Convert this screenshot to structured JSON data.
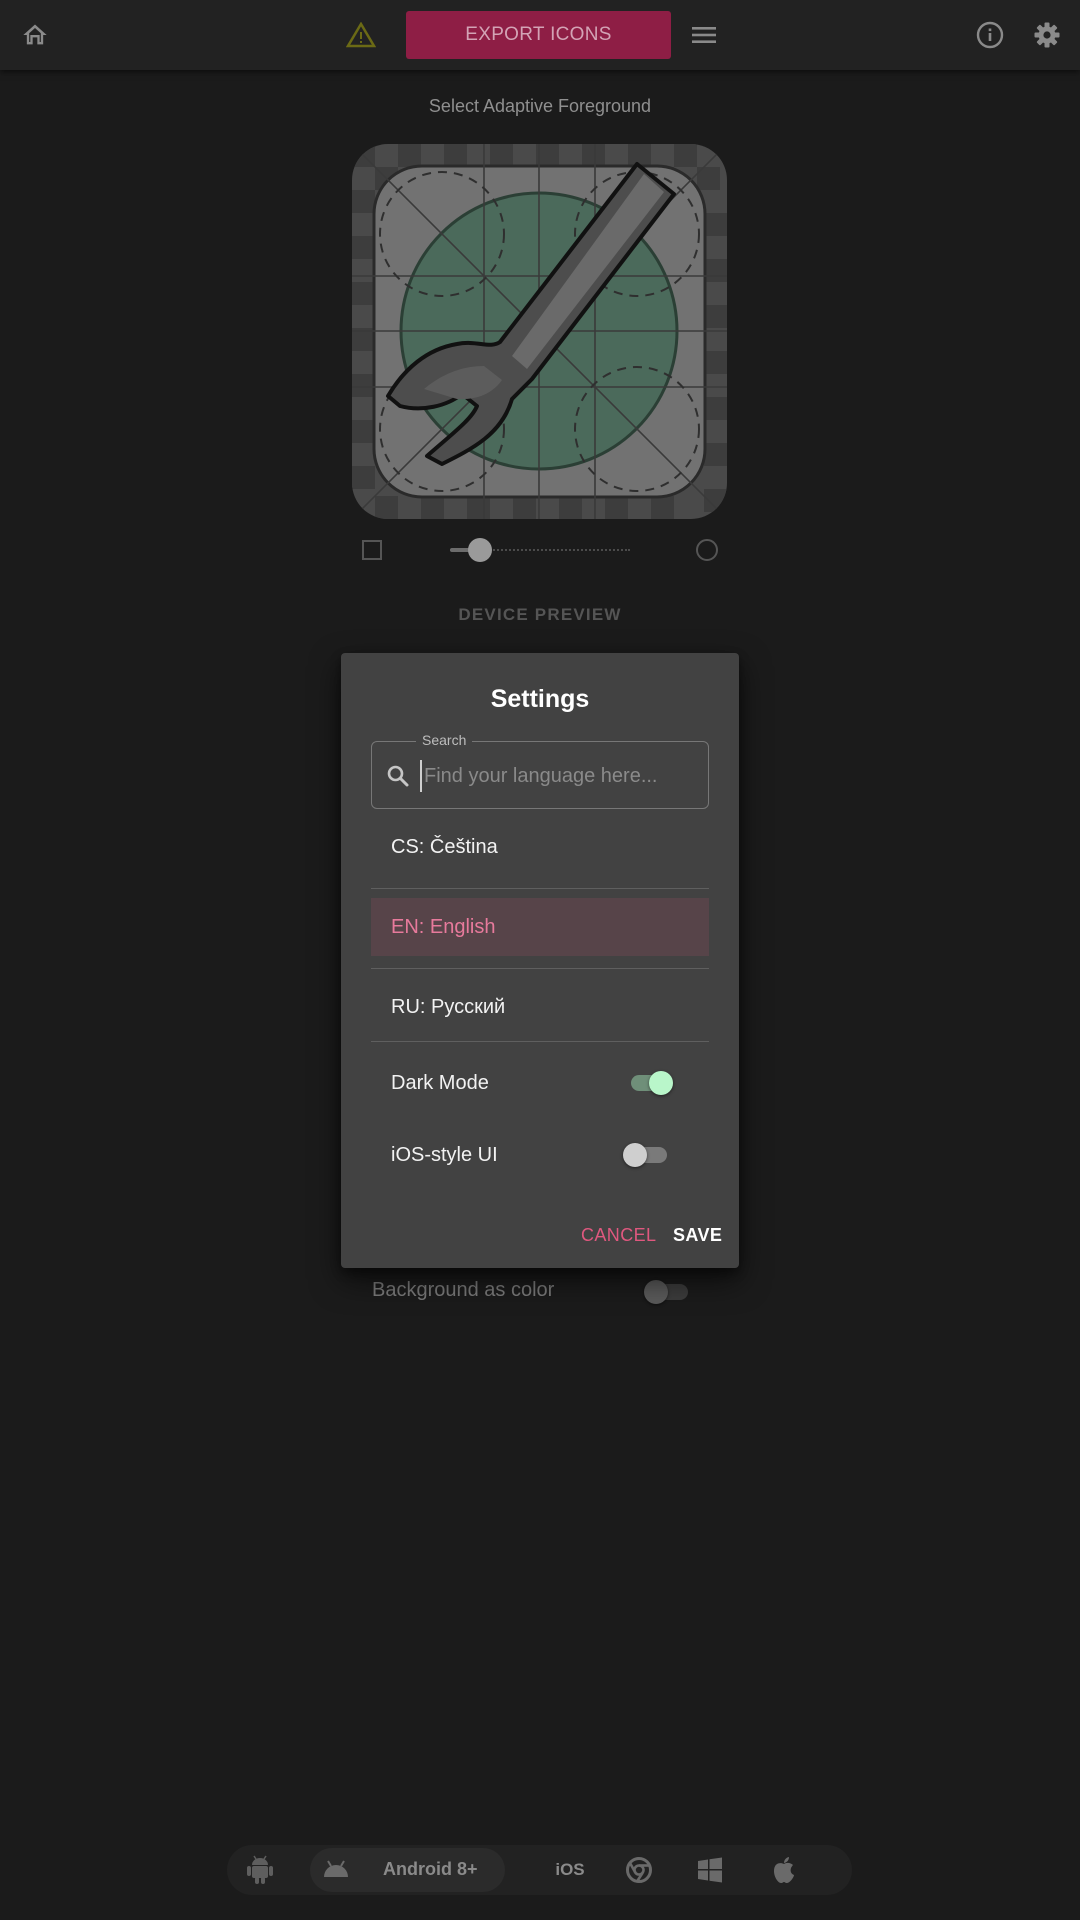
{
  "topbar": {
    "home_icon": "home-icon",
    "warning_icon": "warning-triangle-icon",
    "export_label": "EXPORT ICONS",
    "menu_icon": "hamburger-menu-icon",
    "info_icon": "info-icon",
    "settings_icon": "gear-icon",
    "export_color": "#8e1e45"
  },
  "main": {
    "subtitle": "Select Adaptive Foreground",
    "preview_icon": "wrench-icon",
    "shape_square_icon": "square-shape-icon",
    "shape_circle_icon": "circle-shape-icon",
    "corner_slider_fraction": 0.1,
    "device_preview_label": "DEVICE PREVIEW",
    "background_as_color_label": "Background as color",
    "background_as_color_on": false
  },
  "dialog": {
    "title": "Settings",
    "search": {
      "legend": "Search",
      "placeholder": "Find your language here..."
    },
    "languages": [
      {
        "label": "CS: Čeština",
        "selected": false
      },
      {
        "label": "EN: English",
        "selected": true
      },
      {
        "label": "RU: Русский",
        "selected": false
      }
    ],
    "dark_mode": {
      "label": "Dark Mode",
      "on": true
    },
    "ios_style": {
      "label": "iOS-style UI",
      "on": false
    },
    "cancel_label": "CANCEL",
    "save_label": "SAVE",
    "accent": "#e0587f",
    "toggle_on_color": "#b9f6ca"
  },
  "bottom_nav": {
    "items": [
      {
        "icon": "android-robot-icon"
      },
      {
        "icon": "android-head-icon",
        "label": "Android 8+"
      },
      {
        "label": "iOS"
      },
      {
        "icon": "chrome-icon"
      },
      {
        "icon": "windows-icon"
      },
      {
        "icon": "apple-icon"
      }
    ]
  }
}
